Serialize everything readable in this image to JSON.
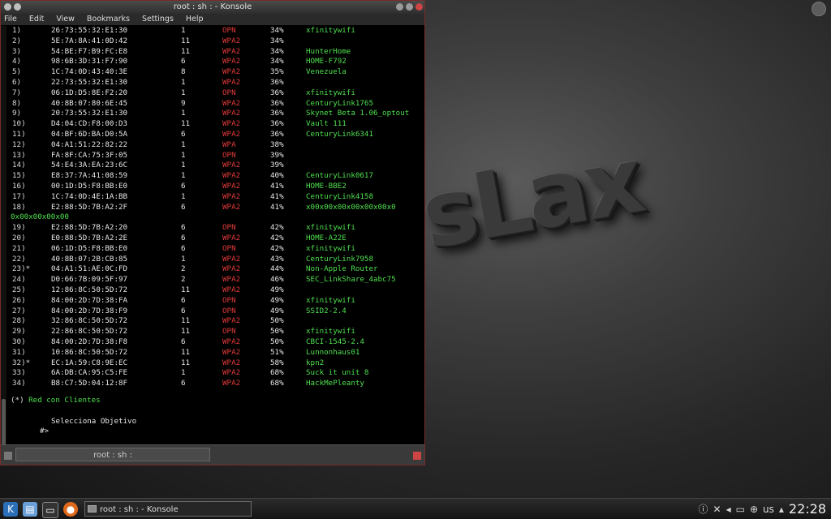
{
  "window": {
    "title": "root : sh : - Konsole",
    "tab_label": "root : sh :"
  },
  "menu": [
    "File",
    "Edit",
    "View",
    "Bookmarks",
    "Settings",
    "Help"
  ],
  "networks": [
    {
      "num": "1)",
      "bssid": "26:73:55:32:E1:30",
      "ch": "1",
      "enc": "OPN",
      "pwr": "34%",
      "essid": "xfinitywifi"
    },
    {
      "num": "2)",
      "bssid": "5E:7A:8A:41:0D:42",
      "ch": "11",
      "enc": "WPA2",
      "pwr": "34%",
      "essid": ""
    },
    {
      "num": "3)",
      "bssid": "54:BE:F7:B9:FC:E8",
      "ch": "11",
      "enc": "WPA2",
      "pwr": "34%",
      "essid": "HunterHome"
    },
    {
      "num": "4)",
      "bssid": "98:6B:3D:31:F7:90",
      "ch": "6",
      "enc": "WPA2",
      "pwr": "34%",
      "essid": "HOME-F792"
    },
    {
      "num": "5)",
      "bssid": "1C:74:0D:43:40:3E",
      "ch": "8",
      "enc": "WPA2",
      "pwr": "35%",
      "essid": "Venezuela"
    },
    {
      "num": "6)",
      "bssid": "22:73:55:32:E1:30",
      "ch": "1",
      "enc": "WPA2",
      "pwr": "36%",
      "essid": ""
    },
    {
      "num": "7)",
      "bssid": "06:1D:D5:8E:F2:20",
      "ch": "1",
      "enc": "OPN",
      "pwr": "36%",
      "essid": "xfinitywifi"
    },
    {
      "num": "8)",
      "bssid": "40:8B:07:80:6E:45",
      "ch": "9",
      "enc": "WPA2",
      "pwr": "36%",
      "essid": "CenturyLink1765"
    },
    {
      "num": "9)",
      "bssid": "20:73:55:32:E1:30",
      "ch": "1",
      "enc": "WPA2",
      "pwr": "36%",
      "essid": "Skynet Beta 1.06_optout"
    },
    {
      "num": "10)",
      "bssid": "D4:04:CD:F8:00:D3",
      "ch": "11",
      "enc": "WPA2",
      "pwr": "36%",
      "essid": "Vault 111"
    },
    {
      "num": "11)",
      "bssid": "04:BF:6D:BA:D0:5A",
      "ch": "6",
      "enc": "WPA2",
      "pwr": "36%",
      "essid": "CenturyLink6341"
    },
    {
      "num": "12)",
      "bssid": "04:A1:51:22:82:22",
      "ch": "1",
      "enc": "WPA",
      "pwr": "38%",
      "essid": ""
    },
    {
      "num": "13)",
      "bssid": "FA:8F:CA:75:3F:05",
      "ch": "1",
      "enc": "OPN",
      "pwr": "39%",
      "essid": ""
    },
    {
      "num": "14)",
      "bssid": "54:E4:3A:EA:23:6C",
      "ch": "1",
      "enc": "WPA2",
      "pwr": "39%",
      "essid": ""
    },
    {
      "num": "15)",
      "bssid": "E8:37:7A:41:08:59",
      "ch": "1",
      "enc": "WPA2",
      "pwr": "40%",
      "essid": "CenturyLink0617"
    },
    {
      "num": "16)",
      "bssid": "00:1D:D5:F8:BB:E0",
      "ch": "6",
      "enc": "WPA2",
      "pwr": "41%",
      "essid": "HOME-BBE2"
    },
    {
      "num": "17)",
      "bssid": "1C:74:0D:4E:1A:BB",
      "ch": "1",
      "enc": "WPA2",
      "pwr": "41%",
      "essid": "CenturyLink4158"
    },
    {
      "num": "18)",
      "bssid": "E2:88:5D:7B:A2:2F",
      "ch": "6",
      "enc": "WPA2",
      "pwr": "41%",
      "essid": "x00x00x00x00x00x00x0"
    },
    {
      "num": "19)",
      "bssid": "E2:88:5D:7B:A2:20",
      "ch": "6",
      "enc": "OPN",
      "pwr": "42%",
      "essid": "xfinitywifi"
    },
    {
      "num": "20)",
      "bssid": "E0:88:5D:7B:A2:2E",
      "ch": "6",
      "enc": "WPA2",
      "pwr": "42%",
      "essid": "HOME-A22E"
    },
    {
      "num": "21)",
      "bssid": "06:1D:D5:F8:BB:E0",
      "ch": "6",
      "enc": "OPN",
      "pwr": "42%",
      "essid": "xfinitywifi"
    },
    {
      "num": "22)",
      "bssid": "40:8B:07:2B:CB:85",
      "ch": "1",
      "enc": "WPA2",
      "pwr": "43%",
      "essid": "CenturyLink7958"
    },
    {
      "num": "23)*",
      "bssid": "04:A1:51:AE:0C:FD",
      "ch": "2",
      "enc": "WPA2",
      "pwr": "44%",
      "essid": "Non-Apple Router"
    },
    {
      "num": "24)",
      "bssid": "D0:66:7B:09:5F:97",
      "ch": "2",
      "enc": "WPA2",
      "pwr": "46%",
      "essid": "SEC_LinkShare_4abc75"
    },
    {
      "num": "25)",
      "bssid": "12:86:8C:50:5D:72",
      "ch": "11",
      "enc": "WPA2",
      "pwr": "49%",
      "essid": ""
    },
    {
      "num": "26)",
      "bssid": "84:00:2D:7D:38:FA",
      "ch": "6",
      "enc": "OPN",
      "pwr": "49%",
      "essid": "xfinitywifi"
    },
    {
      "num": "27)",
      "bssid": "84:00:2D:7D:38:F9",
      "ch": "6",
      "enc": "OPN",
      "pwr": "49%",
      "essid": "SSID2-2.4"
    },
    {
      "num": "28)",
      "bssid": "32:86:8C:50:5D:72",
      "ch": "11",
      "enc": "WPA2",
      "pwr": "50%",
      "essid": ""
    },
    {
      "num": "29)",
      "bssid": "22:86:8C:50:5D:72",
      "ch": "11",
      "enc": "OPN",
      "pwr": "50%",
      "essid": "xfinitywifi"
    },
    {
      "num": "30)",
      "bssid": "84:00:2D:7D:38:F8",
      "ch": "6",
      "enc": "WPA2",
      "pwr": "50%",
      "essid": "CBCI-1545-2.4"
    },
    {
      "num": "31)",
      "bssid": "10:86:8C:50:5D:72",
      "ch": "11",
      "enc": "WPA2",
      "pwr": "51%",
      "essid": "Lunnonhaus01"
    },
    {
      "num": "32)*",
      "bssid": "EC:1A:59:C8:9E:EC",
      "ch": "11",
      "enc": "WPA2",
      "pwr": "58%",
      "essid": "kpn2"
    },
    {
      "num": "33)",
      "bssid": "6A:DB:CA:95:C5:FE",
      "ch": "1",
      "enc": "WPA2",
      "pwr": "68%",
      "essid": "Suck it unit 8"
    },
    {
      "num": "34)",
      "bssid": "B8:C7:5D:04:12:8F",
      "ch": "6",
      "enc": "WPA2",
      "pwr": "68%",
      "essid": "HackMePleanty"
    }
  ],
  "wrap_text": "0x00x00x00x00",
  "note": {
    "star": "(*)",
    "text": " Red con Clientes"
  },
  "select_prompt": "Selecciona Objetivo",
  "prompt": "#>",
  "desktop_logo": "sLax",
  "taskbar": {
    "task_label": "root : sh : - Konsole",
    "keyboard_layout": "us",
    "clock": "22:28"
  },
  "colors": {
    "essid": "#4fe04f",
    "encryption": "#e13a3a",
    "window_border": "#7a2a2a"
  }
}
